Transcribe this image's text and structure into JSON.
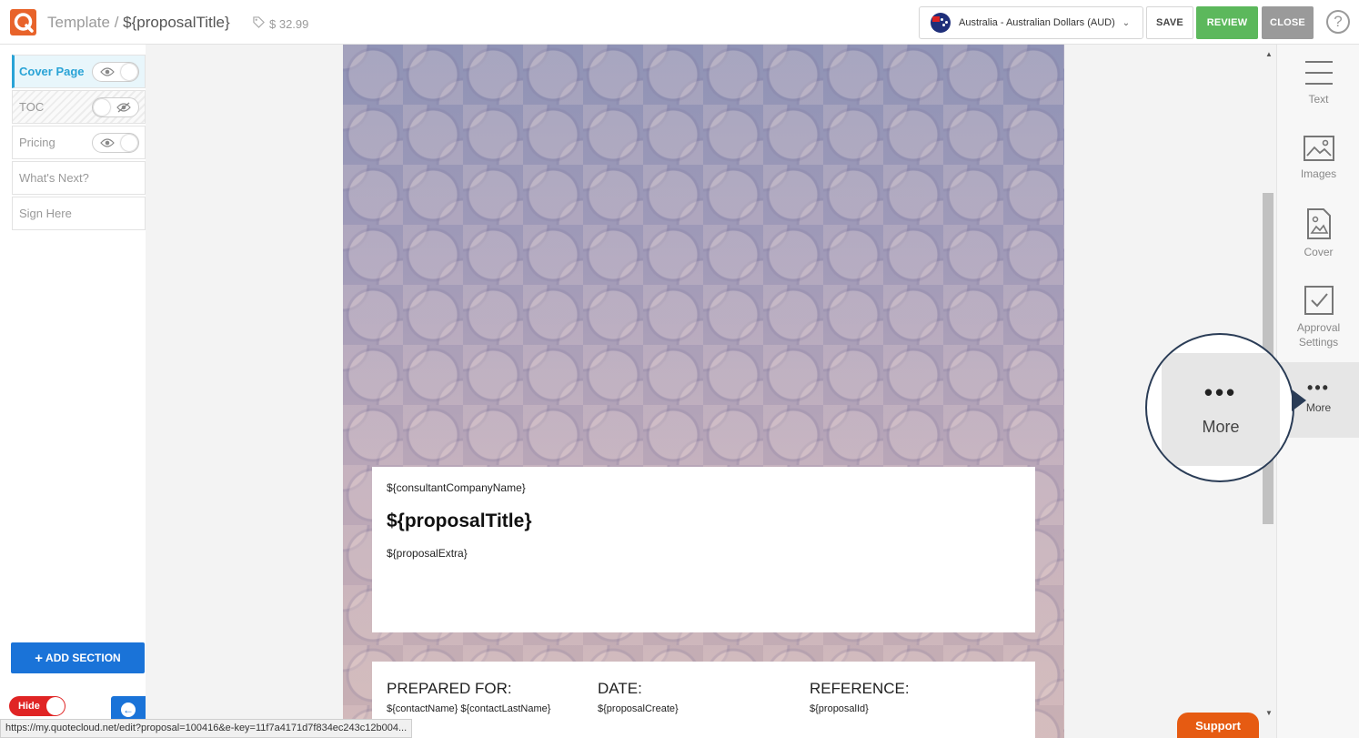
{
  "header": {
    "breadcrumb_root": "Template",
    "breadcrumb_sep": " / ",
    "proposal_title": "${proposalTitle}",
    "price": "$ 32.99",
    "currency_label": "Australia - Australian Dollars (AUD)",
    "save_label": "SAVE",
    "review_label": "REVIEW",
    "close_label": "CLOSE",
    "help_label": "?"
  },
  "sidebar": {
    "sections": [
      {
        "label": "Cover Page",
        "visible": true,
        "active": true
      },
      {
        "label": "TOC",
        "visible": false,
        "active": false
      },
      {
        "label": "Pricing",
        "visible": true,
        "active": false
      },
      {
        "label": "What's Next?",
        "active": false
      },
      {
        "label": "Sign Here",
        "active": false
      }
    ],
    "add_section_label": "ADD SECTION",
    "hide_label": "Hide"
  },
  "document": {
    "company": "${consultantCompanyName}",
    "title": "${proposalTitle}",
    "extra": "${proposalExtra}",
    "prepared_for_heading": "PREPARED FOR:",
    "prepared_for_value": "${contactName} ${contactLastName}",
    "date_heading": "DATE:",
    "date_value": "${proposalCreate}",
    "reference_heading": "REFERENCE:",
    "reference_value": "${proposalId}"
  },
  "tools": {
    "text": "Text",
    "images": "Images",
    "cover": "Cover",
    "approval": "Approval Settings",
    "more": "More"
  },
  "magnifier": {
    "label": "More",
    "dots": "•••"
  },
  "status_url": "https://my.quotecloud.net/edit?proposal=100416&e-key=11f7a4171d7f834ec243c12b004...",
  "support_label": "Support",
  "colors": {
    "brand": "#e8632a",
    "review": "#5cb85c",
    "primary": "#1a73d8",
    "accent": "#29a3d6"
  }
}
